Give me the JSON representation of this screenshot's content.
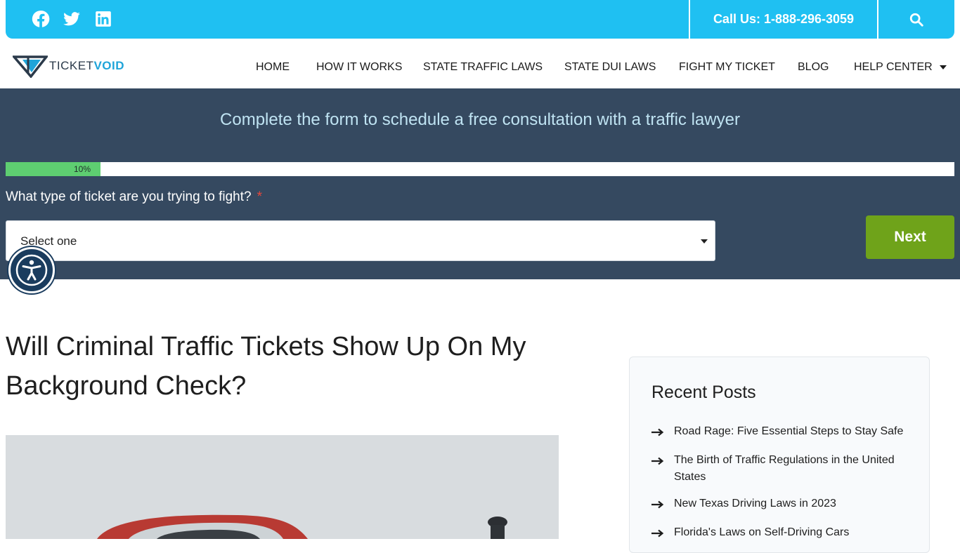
{
  "topbar": {
    "social": [
      "facebook-icon",
      "twitter-icon",
      "linkedin-icon"
    ],
    "call_label": "Call Us: 1-888-296-3059",
    "search_icon": "search-icon",
    "color": "#1fc0f2"
  },
  "logo": {
    "part1": "TICKET",
    "part2": "VOID"
  },
  "nav": {
    "items": [
      {
        "label": "HOME"
      },
      {
        "label": "HOW IT WORKS"
      },
      {
        "label": "STATE TRAFFIC LAWS"
      },
      {
        "label": "STATE DUI LAWS"
      },
      {
        "label": "FIGHT MY TICKET"
      },
      {
        "label": "BLOG"
      },
      {
        "label": "HELP CENTER"
      }
    ]
  },
  "form": {
    "title": "Complete the form to schedule a free consultation with a traffic lawyer",
    "progress_percent": 10,
    "progress_label": "10%",
    "question": "What type of ticket are you trying to fight?",
    "required_mark": "*",
    "select_value": "Select one",
    "next_label": "Next",
    "band_color": "#354960",
    "button_color": "#6fa31a"
  },
  "accessibility": {
    "icon": "accessibility-icon"
  },
  "article": {
    "title": "Will Criminal Traffic Tickets Show Up On My Background Check?"
  },
  "sidebar": {
    "title": "Recent Posts",
    "posts": [
      {
        "label": "Road Rage: Five Essential Steps to Stay Safe"
      },
      {
        "label": "The Birth of Traffic Regulations in the United States"
      },
      {
        "label": "New Texas Driving Laws in 2023"
      },
      {
        "label": "Florida's Laws on Self-Driving Cars"
      }
    ]
  }
}
